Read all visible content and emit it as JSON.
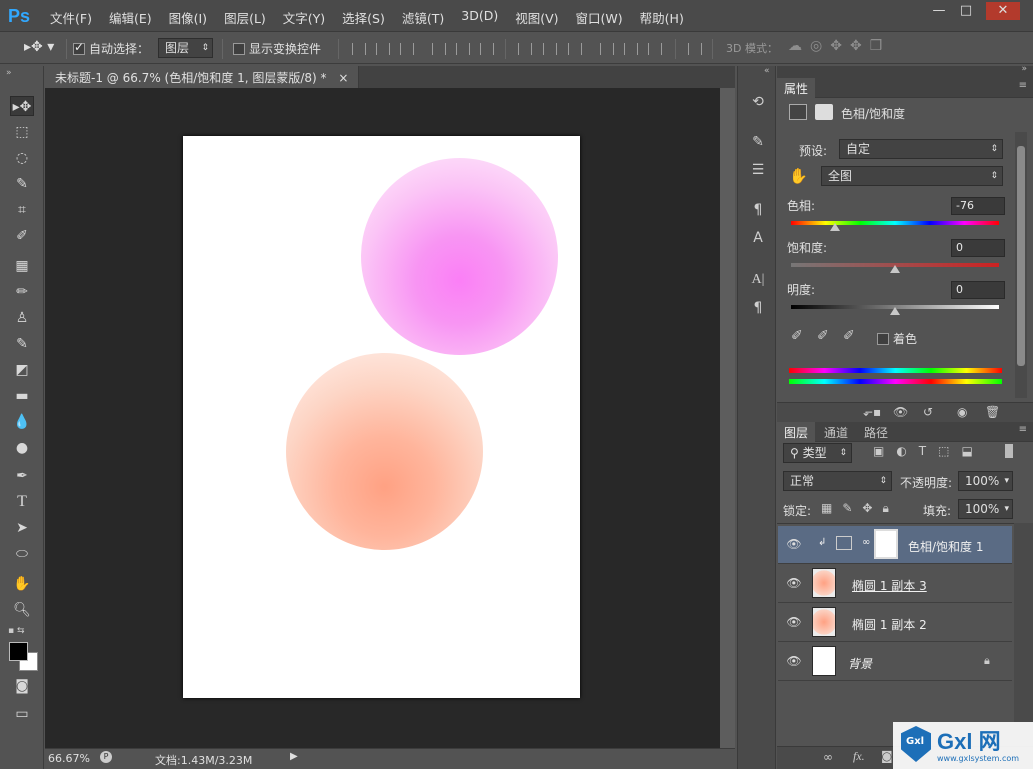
{
  "app": {
    "logo": "Ps"
  },
  "menu": [
    "文件(F)",
    "编辑(E)",
    "图像(I)",
    "图层(L)",
    "文字(Y)",
    "选择(S)",
    "滤镜(T)",
    "3D(D)",
    "视图(V)",
    "窗口(W)",
    "帮助(H)"
  ],
  "window_controls": {
    "minimize": "—",
    "maximize": "□",
    "close": "✕"
  },
  "options": {
    "auto_select_label": "自动选择：",
    "auto_select_checked": true,
    "auto_select_target": "图层",
    "show_transform_label": "显示变换控件",
    "show_transform_checked": false,
    "mode3d_label": "3D 模式："
  },
  "document": {
    "tab_title": "未标题-1 @ 66.7% (色相/饱和度 1, 图层蒙版/8) *",
    "tab_close": "×",
    "zoom": "66.67%",
    "doc_info": "文档:1.43M/3.23M",
    "circles": [
      {
        "name": "pink",
        "color": "#fb7ff6"
      },
      {
        "name": "orange",
        "color": "#ffa183"
      }
    ]
  },
  "properties_panel": {
    "tab": "属性",
    "adjustment_title": "色相/饱和度",
    "preset_label": "预设:",
    "preset_value": "自定",
    "channel_value": "全图",
    "hue_label": "色相:",
    "hue_value": "-76",
    "saturation_label": "饱和度:",
    "saturation_value": "0",
    "lightness_label": "明度:",
    "lightness_value": "0",
    "colorize_label": "着色",
    "colorize_checked": false
  },
  "layers_panel": {
    "tabs": [
      "图层",
      "通道",
      "路径"
    ],
    "filter_type": "类型",
    "blend_mode": "正常",
    "opacity_label": "不透明度:",
    "opacity_value": "100%",
    "lock_label": "锁定:",
    "fill_label": "填充:",
    "fill_value": "100%",
    "layers": [
      {
        "name": "色相/饱和度 1",
        "type": "adjustment",
        "selected": true
      },
      {
        "name": "椭圆 1 副本 3",
        "type": "shape",
        "selected": false
      },
      {
        "name": "椭圆 1 副本 2",
        "type": "shape",
        "selected": false
      },
      {
        "name": "背景",
        "type": "background",
        "selected": false
      }
    ]
  },
  "watermark": {
    "logo": "Gxl 网",
    "url": "www.gxlsystem.com"
  }
}
